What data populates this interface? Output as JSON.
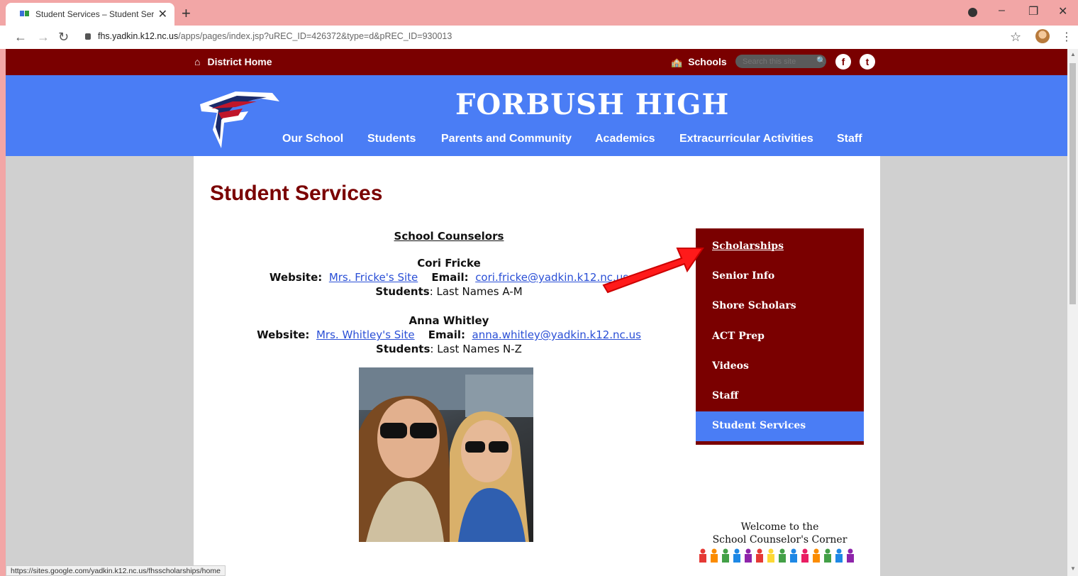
{
  "browser": {
    "tab_title": "Student Services – Student Servic",
    "new_tab_label": "+",
    "url_host": "fhs.yadkin.k12.nc.us",
    "url_path": "/apps/pages/index.jsp?uREC_ID=426372&type=d&pREC_ID=930013",
    "status_url": "https://sites.google.com/yadkin.k12.nc.us/fhsscholarships/home"
  },
  "topbar": {
    "district_home": "District Home",
    "schools": "Schools",
    "search_placeholder": "Search this site"
  },
  "header": {
    "school_name": "FORBUSH HIGH",
    "nav": [
      "Our School",
      "Students",
      "Parents and Community",
      "Academics",
      "Extracurricular Activities",
      "Staff"
    ]
  },
  "main": {
    "page_title": "Student Services",
    "counselors_heading": "School Counselors",
    "counselors": [
      {
        "name": "Cori Fricke",
        "website_label": "Website:",
        "website_link": "Mrs. Fricke's Site",
        "email_label": "Email:",
        "email": "cori.fricke@yadkin.k12.nc.us",
        "students_label": "Students",
        "students_value": ": Last Names A-M"
      },
      {
        "name": "Anna Whitley",
        "website_label": "Website:",
        "website_link": "Mrs. Whitley's Site",
        "email_label": "Email:",
        "email": "anna.whitley@yadkin.k12.nc.us",
        "students_label": "Students",
        "students_value": ": Last Names N-Z"
      }
    ]
  },
  "sidemenu": {
    "items": [
      "Scholarships ",
      "Senior Info",
      "Shore Scholars",
      "ACT Prep",
      "Videos",
      "Staff",
      "Student Services"
    ]
  },
  "welcome": {
    "line1": "Welcome to the",
    "line2": "School Counselor's Corner"
  },
  "colors": {
    "maroon": "#7a0000",
    "blue": "#4a7df5",
    "arrow": "#ff0000"
  }
}
